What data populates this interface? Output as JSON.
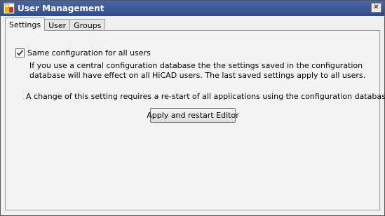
{
  "window": {
    "title": "User Management",
    "close_glyph": "✕",
    "app_icon": "hicad-app-icon"
  },
  "tabs": [
    {
      "label": "Settings",
      "active": true
    },
    {
      "label": "User",
      "active": false
    },
    {
      "label": "Groups",
      "active": false
    }
  ],
  "settings": {
    "same_config_label": "Same configuration for all users",
    "same_config_checked": true,
    "description": "If you use a central configuration database the the settings saved in the configuration database will have effect on all HiCAD users. The last saved settings apply to all users.",
    "restart_note": "A change of this setting requires a re-start of all applications using the configuration database.",
    "apply_button_label": "Apply and restart Editor"
  },
  "colors": {
    "titlebar": "#3a5694",
    "panel": "#f4f4f4",
    "checkmark": "#2a4a8a"
  }
}
